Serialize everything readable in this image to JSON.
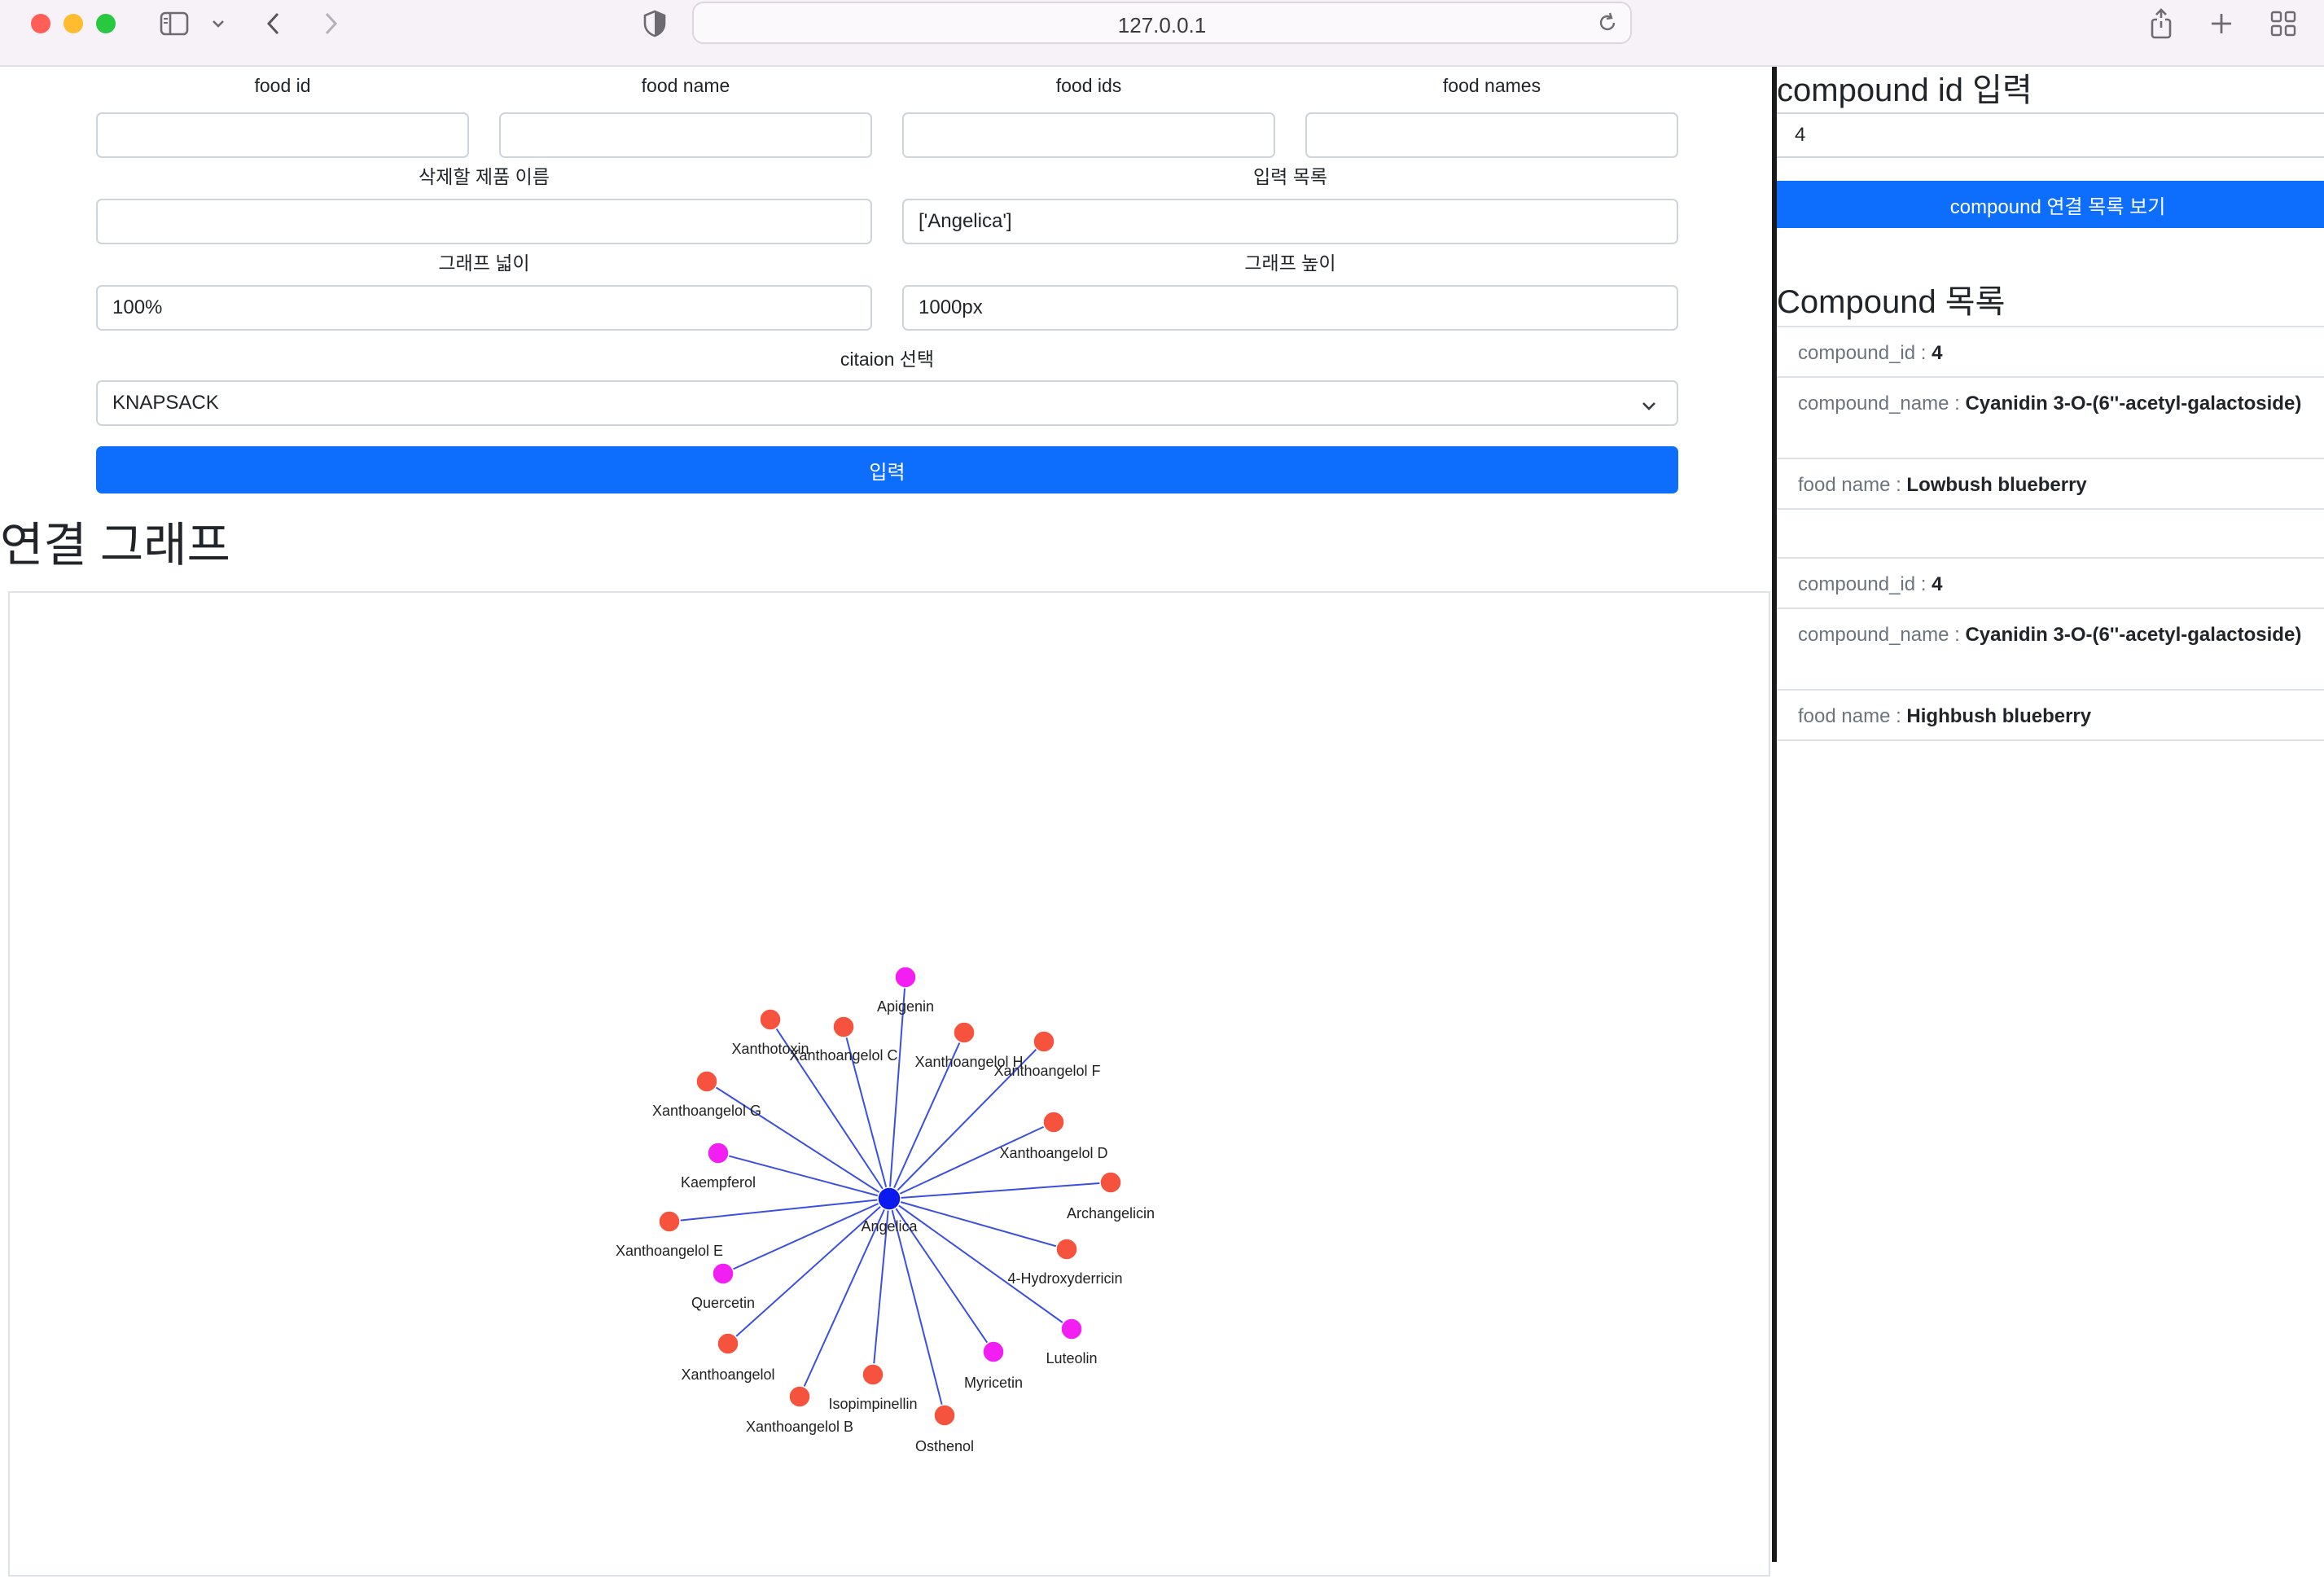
{
  "browser": {
    "url": "127.0.0.1"
  },
  "form": {
    "food_id_label": "food id",
    "food_name_label": "food name",
    "food_ids_label": "food ids",
    "food_names_label": "food names",
    "food_id_value": "",
    "food_name_value": "",
    "food_ids_value": "",
    "food_names_value": "",
    "delete_label": "삭제할 제품 이름",
    "delete_value": "",
    "input_list_label": "입력 목록",
    "input_list_value": "['Angelica']",
    "graph_width_label": "그래프 넓이",
    "graph_width_value": "100%",
    "graph_height_label": "그래프 높이",
    "graph_height_value": "1000px",
    "citation_label": "citaion 선택",
    "citation_value": "KNAPSACK",
    "submit_label": "입력"
  },
  "graph": {
    "title": "연결 그래프",
    "center": {
      "label": "Angelica",
      "color": "#0b1bef"
    },
    "colors": {
      "edge": "#3b4fe0",
      "compound": "#f5533d",
      "flavonoid": "#f21ff2"
    },
    "nodes": [
      {
        "label": "Apigenin",
        "kind": "flavonoid"
      },
      {
        "label": "Xanthoangelol H",
        "kind": "compound"
      },
      {
        "label": "Xanthoangelol F",
        "kind": "compound"
      },
      {
        "label": "Xanthoangelol D",
        "kind": "compound"
      },
      {
        "label": "Archangelicin",
        "kind": "compound"
      },
      {
        "label": "4-Hydroxyderricin",
        "kind": "compound"
      },
      {
        "label": "Luteolin",
        "kind": "flavonoid"
      },
      {
        "label": "Myricetin",
        "kind": "flavonoid"
      },
      {
        "label": "Osthenol",
        "kind": "compound"
      },
      {
        "label": "Isopimpinellin",
        "kind": "compound"
      },
      {
        "label": "Xanthoangelol B",
        "kind": "compound"
      },
      {
        "label": "Xanthoangelol",
        "kind": "compound"
      },
      {
        "label": "Quercetin",
        "kind": "flavonoid"
      },
      {
        "label": "Xanthoangelol E",
        "kind": "compound"
      },
      {
        "label": "Kaempferol",
        "kind": "flavonoid"
      },
      {
        "label": "Xanthoangelol G",
        "kind": "compound"
      },
      {
        "label": "Xanthotoxin",
        "kind": "compound"
      },
      {
        "label": "Xanthoangelol C",
        "kind": "compound"
      }
    ]
  },
  "side": {
    "compound_id_title": "compound id 입력",
    "compound_id_value": "4",
    "show_button_label": "compound 연결 목록 보기",
    "list_title": "Compound 목록",
    "entries": [
      {
        "id_key": "compound_id : ",
        "id_value": "4",
        "name_key": "compound_name : ",
        "name_value": "Cyanidin 3-O-(6''-acetyl-galactoside)",
        "food_key": "food name : ",
        "food_value": "Lowbush blueberry"
      },
      {
        "id_key": "compound_id : ",
        "id_value": "4",
        "name_key": "compound_name : ",
        "name_value": "Cyanidin 3-O-(6''-acetyl-galactoside)",
        "food_key": "food name : ",
        "food_value": "Highbush blueberry"
      }
    ]
  }
}
